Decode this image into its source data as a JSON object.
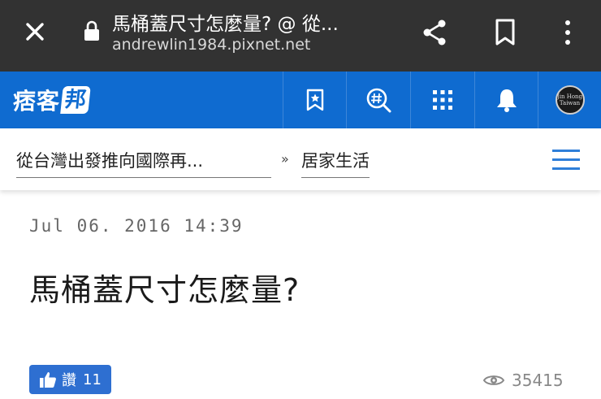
{
  "browser": {
    "title": "馬桶蓋尺寸怎麼量? @ 從...",
    "url": "andrewlin1984.pixnet.net",
    "icons": [
      "close-icon",
      "lock-icon",
      "share-icon",
      "bookmark-icon",
      "more-vert-icon"
    ]
  },
  "site": {
    "logo_text": "痞客",
    "logo_badge": "邦",
    "avatar_text_top": "Jin Hong",
    "avatar_text_bottom": "Taiwan",
    "header_icons": [
      "bookmark-star-icon",
      "hashtag-search-icon",
      "apps-grid-icon",
      "bell-icon",
      "user-avatar"
    ],
    "brand_color": "#0f6bd0"
  },
  "breadcrumb": {
    "blog": "從台灣出發推向國際再...",
    "separator": "»",
    "category": "居家生活"
  },
  "article": {
    "date": "Jul 06. 2016 14:39",
    "title": "馬桶蓋尺寸怎麼量?",
    "like_label": "讚",
    "like_count": "11",
    "views": "35415"
  }
}
